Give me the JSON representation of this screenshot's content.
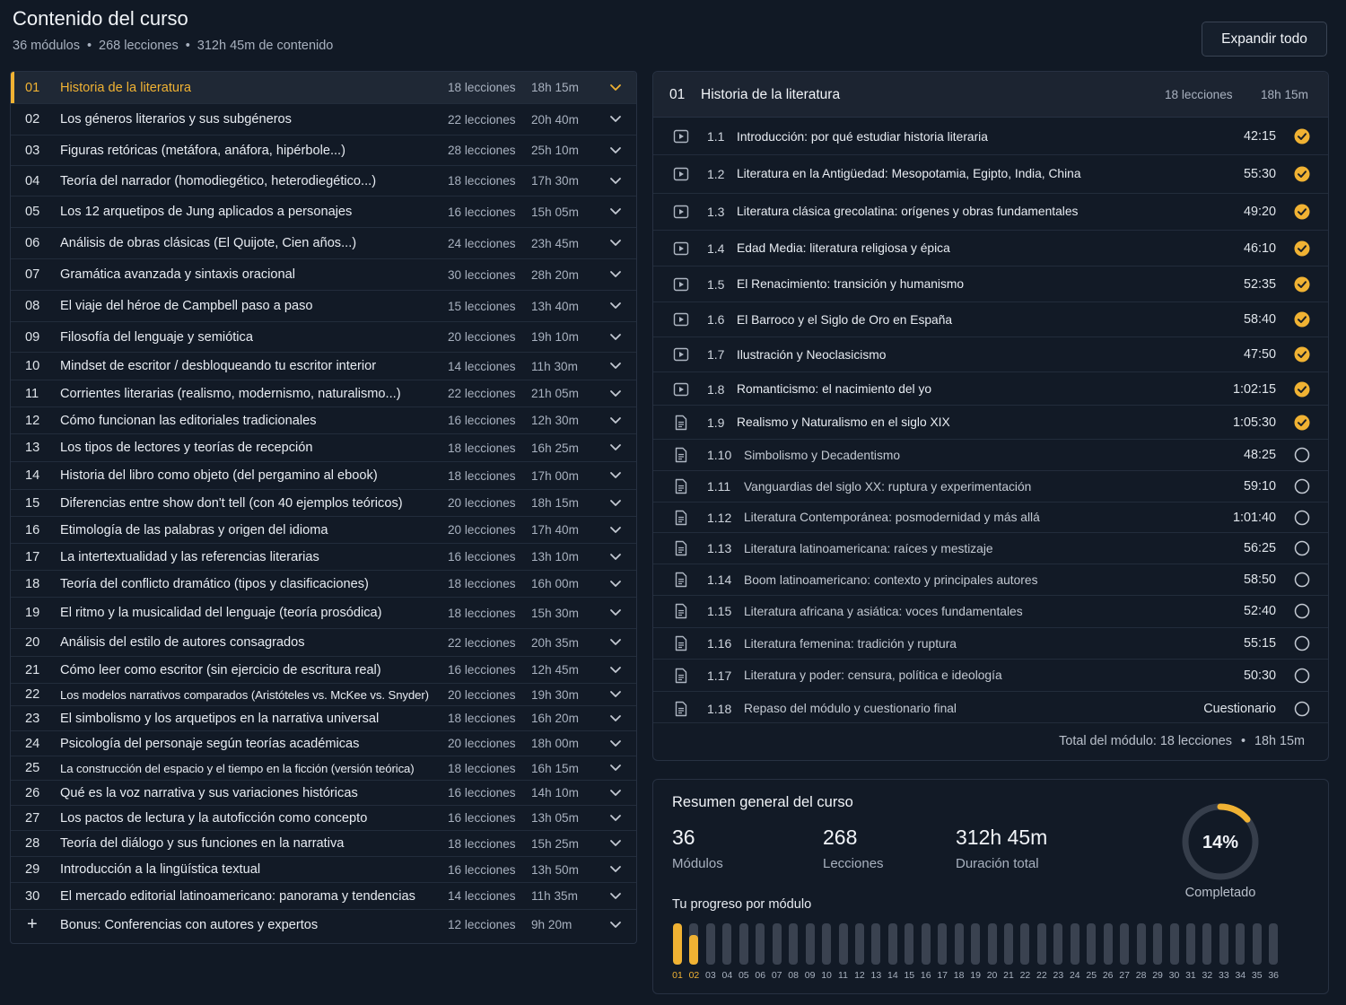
{
  "header": {
    "title": "Contenido del curso",
    "modules": "36 módulos",
    "lessons": "268 lecciones",
    "content": "312h 45m de contenido",
    "separator": "•",
    "expand_label": "Expandir todo"
  },
  "modules": [
    {
      "num": "01",
      "title": "Historia de la literatura",
      "lessons": "18 lecciones",
      "duration": "18h 15m",
      "active": true
    },
    {
      "num": "02",
      "title": "Los géneros literarios y sus subgéneros",
      "lessons": "22 lecciones",
      "duration": "20h 40m"
    },
    {
      "num": "03",
      "title": "Figuras retóricas (metáfora, anáfora, hipérbole...)",
      "lessons": "28 lecciones",
      "duration": "25h 10m"
    },
    {
      "num": "04",
      "title": "Teoría del narrador (homodiegético, heterodiegético...)",
      "lessons": "18 lecciones",
      "duration": "17h 30m"
    },
    {
      "num": "05",
      "title": "Los 12 arquetipos de Jung aplicados a personajes",
      "lessons": "16 lecciones",
      "duration": "15h 05m"
    },
    {
      "num": "06",
      "title": "Análisis de obras clásicas (El Quijote, Cien años...)",
      "lessons": "24 lecciones",
      "duration": "23h 45m"
    },
    {
      "num": "07",
      "title": "Gramática avanzada y sintaxis oracional",
      "lessons": "30 lecciones",
      "duration": "28h 20m"
    },
    {
      "num": "08",
      "title": "El viaje del héroe de Campbell paso a paso",
      "lessons": "15 lecciones",
      "duration": "13h 40m"
    },
    {
      "num": "09",
      "title": "Filosofía del lenguaje y semiótica",
      "lessons": "20 lecciones",
      "duration": "19h 10m"
    },
    {
      "num": "10",
      "title": "Mindset de escritor / desbloqueando tu escritor interior",
      "lessons": "14 lecciones",
      "duration": "11h 30m"
    },
    {
      "num": "11",
      "title": "Corrientes literarias (realismo, modernismo, naturalismo...)",
      "lessons": "22 lecciones",
      "duration": "21h 05m"
    },
    {
      "num": "12",
      "title": "Cómo funcionan las editoriales tradicionales",
      "lessons": "16 lecciones",
      "duration": "12h 30m"
    },
    {
      "num": "13",
      "title": "Los tipos de lectores y teorías de recepción",
      "lessons": "18 lecciones",
      "duration": "16h 25m"
    },
    {
      "num": "14",
      "title": "Historia del libro como objeto (del pergamino al ebook)",
      "lessons": "18 lecciones",
      "duration": "17h 00m"
    },
    {
      "num": "15",
      "title": "Diferencias entre show don't tell (con 40 ejemplos teóricos)",
      "lessons": "20 lecciones",
      "duration": "18h 15m"
    },
    {
      "num": "16",
      "title": "Etimología de las palabras y origen del idioma",
      "lessons": "20 lecciones",
      "duration": "17h 40m"
    },
    {
      "num": "17",
      "title": "La intertextualidad y las referencias literarias",
      "lessons": "16 lecciones",
      "duration": "13h 10m"
    },
    {
      "num": "18",
      "title": "Teoría del conflicto dramático (tipos y clasificaciones)",
      "lessons": "18 lecciones",
      "duration": "16h 00m"
    },
    {
      "num": "19",
      "title": "El ritmo y la musicalidad del lenguaje (teoría prosódica)",
      "lessons": "18 lecciones",
      "duration": "15h 30m"
    },
    {
      "num": "20",
      "title": "Análisis del estilo de autores consagrados",
      "lessons": "22 lecciones",
      "duration": "20h 35m"
    },
    {
      "num": "21",
      "title": "Cómo leer como escritor (sin ejercicio de escritura real)",
      "lessons": "16 lecciones",
      "duration": "12h 45m"
    },
    {
      "num": "22",
      "title": "Los modelos narrativos comparados (Aristóteles vs. McKee vs. Snyder)",
      "lessons": "20 lecciones",
      "duration": "19h 30m",
      "small": true
    },
    {
      "num": "23",
      "title": "El simbolismo y los arquetipos en la narrativa universal",
      "lessons": "18 lecciones",
      "duration": "16h 20m"
    },
    {
      "num": "24",
      "title": "Psicología del personaje según teorías académicas",
      "lessons": "20 lecciones",
      "duration": "18h 00m"
    },
    {
      "num": "25",
      "title": "La construcción del espacio y el tiempo en la ficción (versión teórica)",
      "lessons": "18 lecciones",
      "duration": "16h 15m",
      "small": true
    },
    {
      "num": "26",
      "title": "Qué es la voz narrativa y sus variaciones históricas",
      "lessons": "16 lecciones",
      "duration": "14h 10m"
    },
    {
      "num": "27",
      "title": "Los pactos de lectura y la autoficción como concepto",
      "lessons": "16 lecciones",
      "duration": "13h 05m"
    },
    {
      "num": "28",
      "title": "Teoría del diálogo y sus funciones en la narrativa",
      "lessons": "18 lecciones",
      "duration": "15h 25m"
    },
    {
      "num": "29",
      "title": "Introducción a la lingüística textual",
      "lessons": "16 lecciones",
      "duration": "13h 50m"
    },
    {
      "num": "30",
      "title": "El mercado editorial latinoamericano: panorama y tendencias",
      "lessons": "14 lecciones",
      "duration": "11h 35m"
    },
    {
      "num": "+",
      "title": "Bonus: Conferencias con autores y expertos",
      "lessons": "12 lecciones",
      "duration": "9h 20m",
      "bonus": true
    }
  ],
  "detail": {
    "num": "01",
    "title": "Historia de la literatura",
    "lessons": "18 lecciones",
    "duration": "18h 15m",
    "items": [
      {
        "num": "1.1",
        "title": "Introducción: por qué estudiar historia literaria",
        "duration": "42:15",
        "type": "video",
        "done": true
      },
      {
        "num": "1.2",
        "title": "Literatura en la Antigüedad: Mesopotamia, Egipto, India, China",
        "duration": "55:30",
        "type": "video",
        "done": true
      },
      {
        "num": "1.3",
        "title": "Literatura clásica grecolatina: orígenes y obras fundamentales",
        "duration": "49:20",
        "type": "video",
        "done": true
      },
      {
        "num": "1.4",
        "title": "Edad Media: literatura religiosa y épica",
        "duration": "46:10",
        "type": "video",
        "done": true
      },
      {
        "num": "1.5",
        "title": "El Renacimiento: transición y humanismo",
        "duration": "52:35",
        "type": "video",
        "done": true
      },
      {
        "num": "1.6",
        "title": "El Barroco y el Siglo de Oro en España",
        "duration": "58:40",
        "type": "video",
        "done": true
      },
      {
        "num": "1.7",
        "title": "Ilustración y Neoclasicismo",
        "duration": "47:50",
        "type": "video",
        "done": true
      },
      {
        "num": "1.8",
        "title": "Romanticismo: el nacimiento del yo",
        "duration": "1:02:15",
        "type": "video",
        "done": true
      },
      {
        "num": "1.9",
        "title": "Realismo y Naturalismo en el siglo XIX",
        "duration": "1:05:30",
        "type": "doc",
        "done": true
      },
      {
        "num": "1.10",
        "title": "Simbolismo y Decadentismo",
        "duration": "48:25",
        "type": "doc",
        "done": false
      },
      {
        "num": "1.11",
        "title": "Vanguardias del siglo XX: ruptura y experimentación",
        "duration": "59:10",
        "type": "doc",
        "done": false
      },
      {
        "num": "1.12",
        "title": "Literatura Contemporánea: posmodernidad y más allá",
        "duration": "1:01:40",
        "type": "doc",
        "done": false
      },
      {
        "num": "1.13",
        "title": "Literatura latinoamericana: raíces y mestizaje",
        "duration": "56:25",
        "type": "doc",
        "done": false
      },
      {
        "num": "1.14",
        "title": "Boom latinoamericano: contexto y principales autores",
        "duration": "58:50",
        "type": "doc",
        "done": false
      },
      {
        "num": "1.15",
        "title": "Literatura africana y asiática: voces fundamentales",
        "duration": "52:40",
        "type": "doc",
        "done": false
      },
      {
        "num": "1.16",
        "title": "Literatura femenina: tradición y ruptura",
        "duration": "55:15",
        "type": "doc",
        "done": false
      },
      {
        "num": "1.17",
        "title": "Literatura y poder: censura, política e ideología",
        "duration": "50:30",
        "type": "doc",
        "done": false
      },
      {
        "num": "1.18",
        "title": "Repaso del módulo y cuestionario final",
        "duration": "Cuestionario",
        "type": "doc",
        "done": false
      }
    ],
    "footer_label": "Total del módulo: 18 lecciones",
    "footer_sep": "•",
    "footer_dur": "18h 15m"
  },
  "summary": {
    "title": "Resumen general del curso",
    "stats": [
      {
        "value": "36",
        "label": "Módulos"
      },
      {
        "value": "268",
        "label": "Lecciones"
      },
      {
        "value": "312h 45m",
        "label": "Duración total"
      }
    ],
    "percent_label": "14%",
    "percent_value": 0.14,
    "completed_label": "Completado",
    "progress_title": "Tu progreso por módulo",
    "progress": [
      {
        "label": "01",
        "value": 1.0
      },
      {
        "label": "02",
        "value": 0.72
      },
      {
        "label": "03",
        "value": 0
      },
      {
        "label": "04",
        "value": 0
      },
      {
        "label": "05",
        "value": 0
      },
      {
        "label": "06",
        "value": 0
      },
      {
        "label": "07",
        "value": 0
      },
      {
        "label": "08",
        "value": 0
      },
      {
        "label": "09",
        "value": 0
      },
      {
        "label": "10",
        "value": 0
      },
      {
        "label": "11",
        "value": 0
      },
      {
        "label": "12",
        "value": 0
      },
      {
        "label": "13",
        "value": 0
      },
      {
        "label": "14",
        "value": 0
      },
      {
        "label": "15",
        "value": 0
      },
      {
        "label": "16",
        "value": 0
      },
      {
        "label": "17",
        "value": 0
      },
      {
        "label": "18",
        "value": 0
      },
      {
        "label": "19",
        "value": 0
      },
      {
        "label": "20",
        "value": 0
      },
      {
        "label": "21",
        "value": 0
      },
      {
        "label": "22",
        "value": 0
      },
      {
        "label": "22",
        "value": 0
      },
      {
        "label": "23",
        "value": 0
      },
      {
        "label": "24",
        "value": 0
      },
      {
        "label": "25",
        "value": 0
      },
      {
        "label": "26",
        "value": 0
      },
      {
        "label": "27",
        "value": 0
      },
      {
        "label": "28",
        "value": 0
      },
      {
        "label": "29",
        "value": 0
      },
      {
        "label": "30",
        "value": 0
      },
      {
        "label": "31",
        "value": 0
      },
      {
        "label": "32",
        "value": 0
      },
      {
        "label": "33",
        "value": 0
      },
      {
        "label": "34",
        "value": 0
      },
      {
        "label": "35",
        "value": 0
      },
      {
        "label": "36",
        "value": 0
      }
    ]
  },
  "colors": {
    "accent": "#f0b233",
    "background": "#111925",
    "panel": "#121a26",
    "border": "#273142",
    "muted_text": "#a8b1bf"
  },
  "icons": {
    "chevron": "chevron-down-icon",
    "video": "play-video-icon",
    "doc": "document-icon",
    "done": "check-circle-icon",
    "pending": "empty-circle-icon",
    "bonus": "plus-icon"
  }
}
